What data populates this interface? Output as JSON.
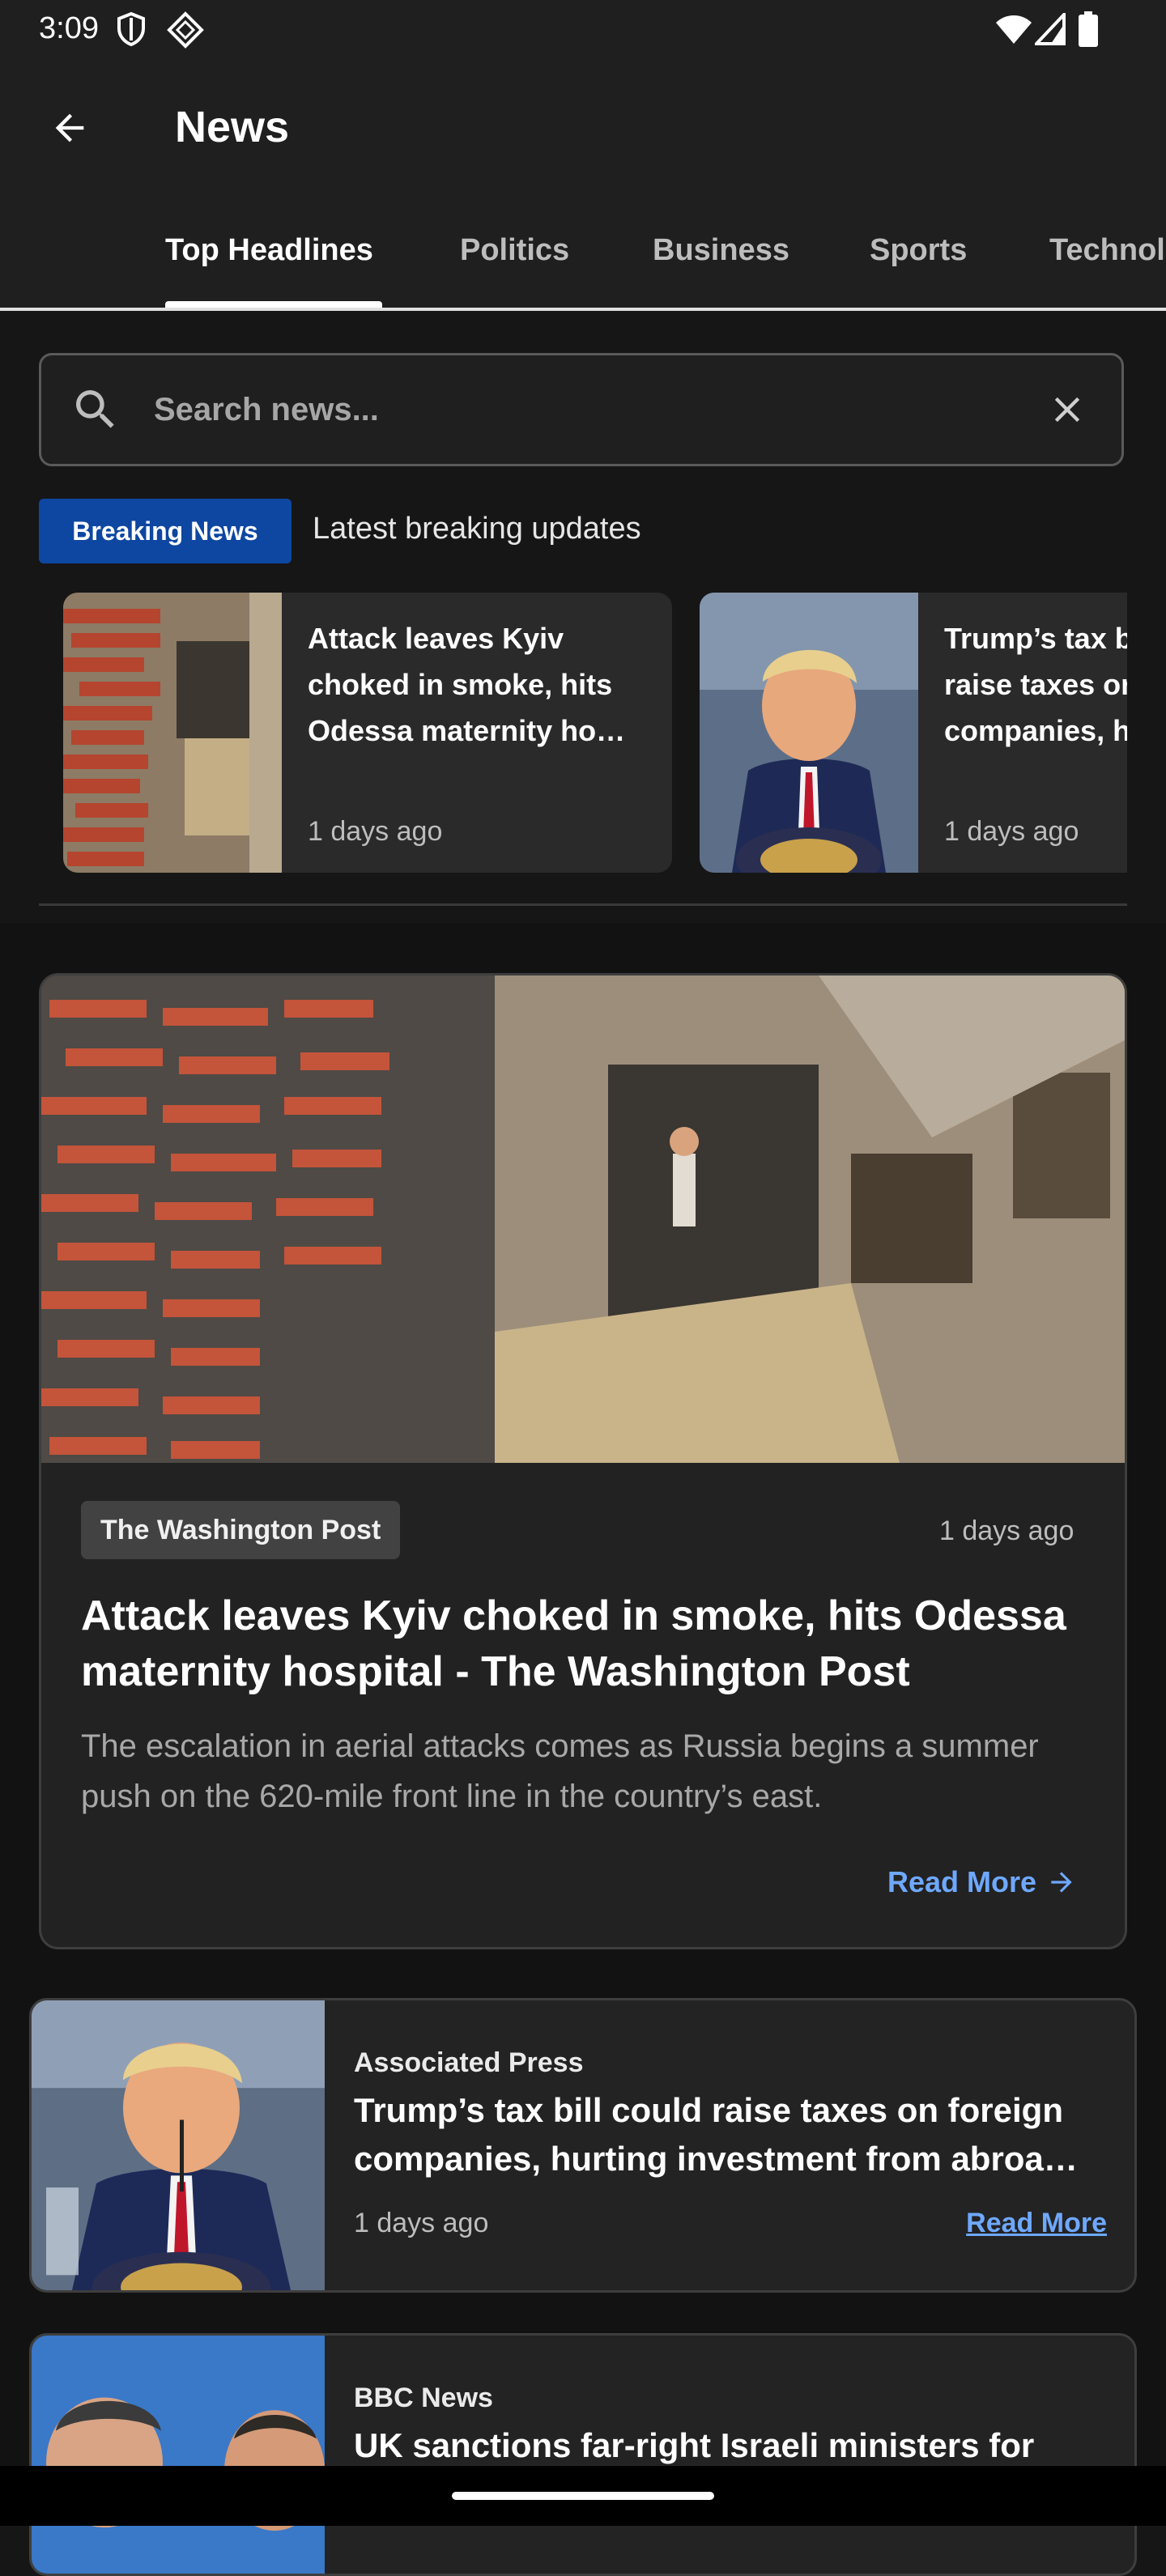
{
  "status_bar": {
    "time": "3:09"
  },
  "app_bar": {
    "title": "News"
  },
  "tabs": [
    {
      "label": "Top Headlines",
      "active": true
    },
    {
      "label": "Politics"
    },
    {
      "label": "Business"
    },
    {
      "label": "Sports"
    },
    {
      "label": "Technol"
    }
  ],
  "search": {
    "placeholder": "Search news...",
    "value": ""
  },
  "breaking": {
    "badge": "Breaking News",
    "description": "Latest breaking updates",
    "items": [
      {
        "title": "Attack leaves Kyiv choked in smoke, hits Odessa maternity ho…",
        "date": "1 days ago"
      },
      {
        "title": "Trump’s tax bill could raise taxes on foreign companies, hurting",
        "date": "1 days ago"
      }
    ]
  },
  "featured": {
    "source": "The Washington Post",
    "date": "1 days ago",
    "title": "Attack leaves Kyiv choked in smoke, hits Odessa maternity hospital - The Washington Post",
    "description": "The escalation in aerial attacks comes as Russia begins a summer push on the 620-mile front line in the country’s east.",
    "read_more": "Read More"
  },
  "articles": [
    {
      "source": "Associated Press",
      "title": "Trump’s tax bill could raise taxes on foreign companies, hurting investment from abroa…",
      "date": "1 days ago",
      "read_more": "Read More"
    },
    {
      "source": "BBC News",
      "title": "UK sanctions far-right Israeli ministers for"
    }
  ],
  "colors": {
    "background": "#161616",
    "card": "#222222",
    "breaking_badge": "#0d47a1",
    "link": "#6ea8ff"
  },
  "icons": [
    "back-arrow-icon",
    "search-icon",
    "close-icon",
    "arrow-right-icon",
    "wifi-icon",
    "signal-icon",
    "battery-icon",
    "shield-icon",
    "diamond-grid-icon"
  ]
}
